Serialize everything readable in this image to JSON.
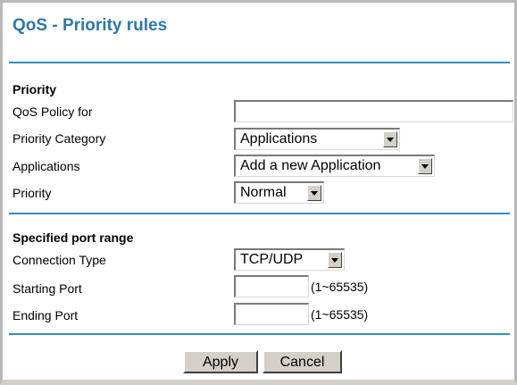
{
  "page": {
    "title": "QoS - Priority rules"
  },
  "priority_section": {
    "heading": "Priority",
    "policy_label": "QoS Policy for",
    "policy_value": "",
    "category_label": "Priority Category",
    "category_value": "Applications",
    "applications_label": "Applications",
    "applications_value": "Add a new Application",
    "priority_label": "Priority",
    "priority_value": "Normal"
  },
  "port_section": {
    "heading": "Specified port range",
    "connection_label": "Connection Type",
    "connection_value": "TCP/UDP",
    "start_label": "Starting Port",
    "start_value": "",
    "start_hint": "(1~65535)",
    "end_label": "Ending Port",
    "end_value": "",
    "end_hint": "(1~65535)"
  },
  "actions": {
    "apply_label": "Apply",
    "cancel_label": "Cancel"
  },
  "icons": {
    "dropdown": "chevron-down-icon"
  },
  "colors": {
    "title": "#2e78a8",
    "rule": "#2e8fc0",
    "button_face": "#d4d0c8"
  }
}
